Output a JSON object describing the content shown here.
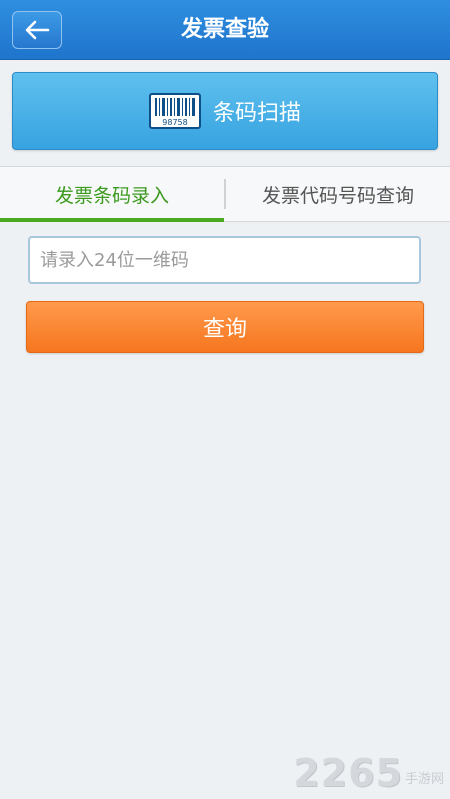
{
  "header": {
    "title": "发票查验",
    "back_icon": "arrow-left-icon"
  },
  "scan": {
    "label": "条码扫描",
    "icon": "barcode-icon",
    "barcode_digits": "98758"
  },
  "tabs": [
    {
      "label": "发票条码录入",
      "active": true
    },
    {
      "label": "发票代码号码查询",
      "active": false
    }
  ],
  "input": {
    "placeholder": "请录入24位一维码",
    "value": ""
  },
  "query": {
    "label": "查询"
  },
  "watermark": {
    "number": "2265",
    "text": "手游网"
  },
  "colors": {
    "header": "#2684d8",
    "scan_button": "#4bb2e8",
    "active_tab": "#4aaa20",
    "query_button": "#f7832e"
  }
}
